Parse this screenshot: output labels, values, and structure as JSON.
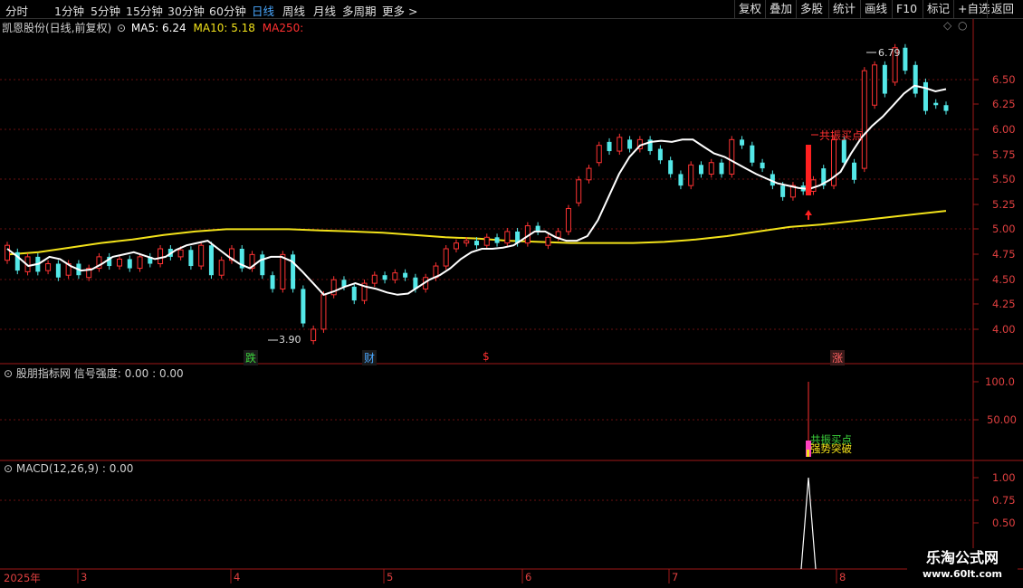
{
  "toolbar": {
    "tabs": [
      "分时",
      "1分钟",
      "5分钟",
      "15分钟",
      "30分钟",
      "60分钟",
      "日线",
      "周线",
      "月线",
      "多周期",
      "更多 >"
    ],
    "active_tab": "日线",
    "right_buttons": [
      "复权",
      "叠加",
      "多股",
      "统计",
      "画线",
      "F10",
      "标记",
      "+自选",
      "返回"
    ]
  },
  "main_panel": {
    "stock_title": "凯恩股份(日线,前复权)",
    "ma5": "MA5: 6.24",
    "ma10": "MA10: 5.18",
    "ma250": "MA250:",
    "y_ticks": [
      "6.50",
      "6.25",
      "6.00",
      "5.75",
      "5.50",
      "5.25",
      "5.00",
      "4.75",
      "4.50",
      "4.25",
      "4.00"
    ],
    "high_label": "6.79",
    "low_label": "3.90",
    "signal_label": "共振买点",
    "event_markers": [
      "跌",
      "财",
      "$",
      "涨"
    ]
  },
  "indicator_panel": {
    "title": "股朋指标网 信号强度: 0.00 : 0.00",
    "y_ticks": [
      "100.0",
      "50.00"
    ],
    "label1": "共振买点",
    "label2": "强势突破"
  },
  "macd_panel": {
    "title": "MACD(12,26,9) : 0.00",
    "y_ticks": [
      "1.00",
      "0.75",
      "0.50"
    ]
  },
  "date_axis": {
    "year": "2025年",
    "months": [
      "3",
      "4",
      "5",
      "6",
      "7",
      "8"
    ]
  },
  "watermark": {
    "brand": "乐淘公式网",
    "url": "www.60lt.com"
  },
  "colors": {
    "up": "#ff3333",
    "down": "#54e8e8",
    "ma5": "#ffffff",
    "ma250": "#f2e21a",
    "grid": "#7a1010",
    "active_tab": "#4aa8ff"
  },
  "chart_data": {
    "type": "candlestick",
    "price_range": [
      3.85,
      6.85
    ],
    "series": [
      {
        "name": "MA5",
        "values": [
          4.85,
          4.78,
          4.7,
          4.72,
          4.78,
          4.76,
          4.7,
          4.66,
          4.67,
          4.72,
          4.78,
          4.8,
          4.82,
          4.79,
          4.76,
          4.78,
          4.84,
          4.88,
          4.9,
          4.92,
          4.85,
          4.78,
          4.72,
          4.68,
          4.75,
          4.78,
          4.78,
          4.74,
          4.65,
          4.55,
          4.45,
          4.48,
          4.52,
          4.55,
          4.52,
          4.5,
          4.47,
          4.45,
          4.46,
          4.52,
          4.58,
          4.62,
          4.68,
          4.76,
          4.82,
          4.85,
          4.85,
          4.86,
          4.88,
          4.94,
          5.0,
          5.0,
          4.95,
          4.92,
          4.92,
          4.96,
          5.1,
          5.3,
          5.5,
          5.65,
          5.75,
          5.78,
          5.79,
          5.78,
          5.8,
          5.8,
          5.74,
          5.68,
          5.65,
          5.6,
          5.55,
          5.5,
          5.46,
          5.42,
          5.4,
          5.38,
          5.37,
          5.4,
          5.45,
          5.52,
          5.68,
          5.82,
          5.92,
          6.0,
          6.1,
          6.2,
          6.27,
          6.25,
          6.22,
          6.24
        ]
      },
      {
        "name": "MA250",
        "values": [
          4.8,
          4.82,
          4.86,
          4.9,
          4.93,
          4.97,
          5.0,
          5.02,
          5.02,
          5.02,
          5.01,
          5.0,
          4.99,
          4.97,
          4.95,
          4.94,
          4.92,
          4.91,
          4.9,
          4.9,
          4.9,
          4.91,
          4.93,
          4.96,
          5.0,
          5.04,
          5.06,
          5.09,
          5.12,
          5.15,
          5.18
        ]
      }
    ],
    "candles_note": "ordinal bars: open/close in price units",
    "candles": [
      [
        4.75,
        4.88
      ],
      [
        4.82,
        4.66
      ],
      [
        4.65,
        4.78
      ],
      [
        4.78,
        4.65
      ],
      [
        4.66,
        4.72
      ],
      [
        4.72,
        4.6
      ],
      [
        4.62,
        4.72
      ],
      [
        4.72,
        4.62
      ],
      [
        4.6,
        4.68
      ],
      [
        4.68,
        4.78
      ],
      [
        4.78,
        4.7
      ],
      [
        4.7,
        4.76
      ],
      [
        4.76,
        4.68
      ],
      [
        4.68,
        4.78
      ],
      [
        4.78,
        4.72
      ],
      [
        4.72,
        4.85
      ],
      [
        4.85,
        4.78
      ],
      [
        4.78,
        4.84
      ],
      [
        4.84,
        4.7
      ],
      [
        4.7,
        4.88
      ],
      [
        4.88,
        4.62
      ],
      [
        4.62,
        4.75
      ],
      [
        4.75,
        4.85
      ],
      [
        4.85,
        4.68
      ],
      [
        4.68,
        4.8
      ],
      [
        4.8,
        4.62
      ],
      [
        4.62,
        4.5
      ],
      [
        4.5,
        4.8
      ],
      [
        4.8,
        4.5
      ],
      [
        4.5,
        4.2
      ],
      [
        4.05,
        4.15
      ],
      [
        4.15,
        4.45
      ],
      [
        4.45,
        4.58
      ],
      [
        4.58,
        4.52
      ],
      [
        4.52,
        4.4
      ],
      [
        4.4,
        4.55
      ],
      [
        4.55,
        4.62
      ],
      [
        4.62,
        4.58
      ],
      [
        4.58,
        4.64
      ],
      [
        4.64,
        4.6
      ],
      [
        4.6,
        4.5
      ],
      [
        4.5,
        4.6
      ],
      [
        4.6,
        4.7
      ],
      [
        4.7,
        4.85
      ],
      [
        4.85,
        4.9
      ],
      [
        4.9,
        4.92
      ],
      [
        4.92,
        4.88
      ],
      [
        4.88,
        4.95
      ],
      [
        4.95,
        4.9
      ],
      [
        4.9,
        5.0
      ],
      [
        5.0,
        4.9
      ],
      [
        4.9,
        5.05
      ],
      [
        5.05,
        5.0
      ],
      [
        4.88,
        4.95
      ],
      [
        4.95,
        5.0
      ],
      [
        5.0,
        5.2
      ],
      [
        5.25,
        5.45
      ],
      [
        5.45,
        5.55
      ],
      [
        5.6,
        5.75
      ],
      [
        5.78,
        5.7
      ],
      [
        5.7,
        5.82
      ],
      [
        5.8,
        5.72
      ],
      [
        5.72,
        5.8
      ],
      [
        5.8,
        5.7
      ],
      [
        5.72,
        5.62
      ],
      [
        5.62,
        5.5
      ],
      [
        5.5,
        5.4
      ],
      [
        5.4,
        5.58
      ],
      [
        5.58,
        5.5
      ],
      [
        5.5,
        5.6
      ],
      [
        5.6,
        5.5
      ],
      [
        5.5,
        5.8
      ],
      [
        5.8,
        5.75
      ],
      [
        5.75,
        5.6
      ],
      [
        5.6,
        5.55
      ],
      [
        5.5,
        5.4
      ],
      [
        5.4,
        5.3
      ],
      [
        5.3,
        5.4
      ],
      [
        5.4,
        5.35
      ],
      [
        5.35,
        5.45
      ],
      [
        5.55,
        5.4
      ],
      [
        5.4,
        5.8
      ],
      [
        5.8,
        5.6
      ],
      [
        5.6,
        5.45
      ],
      [
        5.55,
        6.4
      ],
      [
        6.1,
        6.45
      ],
      [
        6.45,
        6.2
      ],
      [
        6.3,
        6.6
      ],
      [
        6.6,
        6.4
      ],
      [
        6.45,
        6.2
      ],
      [
        6.3,
        6.05
      ],
      [
        6.12,
        6.1
      ],
      [
        6.1,
        6.05
      ]
    ]
  }
}
